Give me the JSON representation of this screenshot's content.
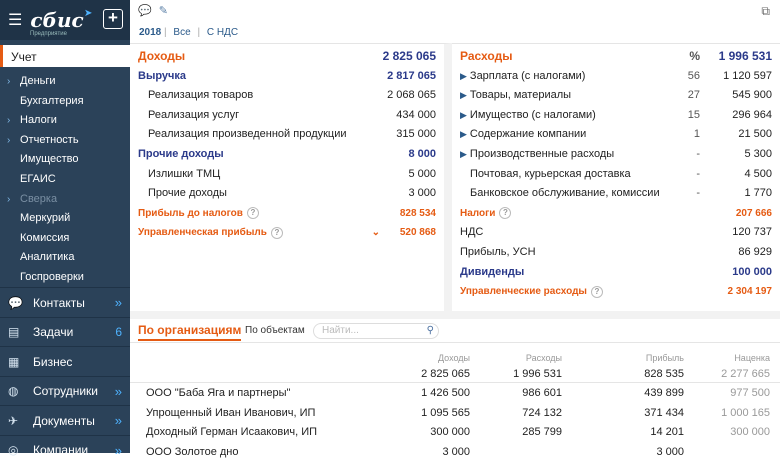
{
  "app": {
    "logo": "сбис",
    "logo_sub": "Предприятие",
    "active_section": "Учет"
  },
  "sidebar": {
    "items": [
      {
        "label": "Деньги",
        "arrow": true
      },
      {
        "label": "Бухгалтерия",
        "arrow": false
      },
      {
        "label": "Налоги",
        "arrow": true
      },
      {
        "label": "Отчетность",
        "arrow": true
      },
      {
        "label": "Имущество",
        "arrow": false
      },
      {
        "label": "ЕГАИС",
        "arrow": false
      },
      {
        "label": "Сверка",
        "arrow": true
      },
      {
        "label": "Меркурий",
        "arrow": false
      },
      {
        "label": "Комиссия",
        "arrow": false
      },
      {
        "label": "Аналитика",
        "arrow": false
      },
      {
        "label": "Госпроверки",
        "arrow": false
      }
    ],
    "sections": [
      {
        "label": "Контакты",
        "icon": "chat-icon",
        "badge": "»"
      },
      {
        "label": "Задачи",
        "icon": "tasks-icon",
        "badge": "6"
      },
      {
        "label": "Бизнес",
        "icon": "business-icon",
        "badge": ""
      },
      {
        "label": "Сотрудники",
        "icon": "people-icon",
        "badge": "»"
      },
      {
        "label": "Документы",
        "icon": "documents-icon",
        "badge": "»"
      },
      {
        "label": "Компании",
        "icon": "companies-icon",
        "badge": "»"
      }
    ]
  },
  "filters": {
    "year": "2018",
    "scope": "Все",
    "vat": "С НДС"
  },
  "income": {
    "header": {
      "label": "Доходы",
      "value": "2 825 065"
    },
    "rows": [
      {
        "label": "Выручка",
        "value": "2 817 065",
        "style": "bold"
      },
      {
        "label": "Реализация товаров",
        "value": "2 068 065",
        "style": "ind"
      },
      {
        "label": "Реализация услуг",
        "value": "434 000",
        "style": "ind"
      },
      {
        "label": "Реализация произведенной продукции",
        "value": "315 000",
        "style": "ind"
      },
      {
        "label": "Прочие доходы",
        "value": "8 000",
        "style": "bold"
      },
      {
        "label": "Излишки ТМЦ",
        "value": "5 000",
        "style": "ind"
      },
      {
        "label": "Прочие доходы",
        "value": "3 000",
        "style": "ind"
      }
    ],
    "profit_before_tax": {
      "label": "Прибыль до налогов",
      "value": "828 534"
    },
    "managerial_profit": {
      "label": "Управленческая прибыль",
      "value": "520 868"
    }
  },
  "expenses": {
    "header": {
      "label": "Расходы",
      "pct": "%",
      "value": "1 996 531"
    },
    "rows": [
      {
        "label": "Зарплата (с налогами)",
        "pct": "56",
        "value": "1 120 597",
        "tri": true
      },
      {
        "label": "Товары, материалы",
        "pct": "27",
        "value": "545 900",
        "tri": true
      },
      {
        "label": "Имущество (с налогами)",
        "pct": "15",
        "value": "296 964",
        "tri": true
      },
      {
        "label": "Содержание компании",
        "pct": "1",
        "value": "21 500",
        "tri": true
      },
      {
        "label": "Производственные расходы",
        "pct": "-",
        "value": "5 300",
        "tri": true
      },
      {
        "label": "Почтовая, курьерская доставка",
        "pct": "-",
        "value": "4 500",
        "tri": false
      },
      {
        "label": "Банковское обслуживание, комиссии",
        "pct": "-",
        "value": "1 770",
        "tri": false
      }
    ],
    "taxes": {
      "label": "Налоги",
      "value": "207 666"
    },
    "tax_rows": [
      {
        "label": "НДС",
        "value": "120 737"
      },
      {
        "label": "Прибыль, УСН",
        "value": "86 929"
      }
    ],
    "dividends": {
      "label": "Дивиденды",
      "value": "100 000"
    },
    "managerial_expenses": {
      "label": "Управленческие расходы",
      "value": "2 304 197"
    }
  },
  "orgs": {
    "tab_active": "По организациям",
    "tab_other": "По объектам",
    "search_placeholder": "Найти...",
    "columns": [
      "Доходы",
      "Расходы",
      "Прибыль",
      "Наценка"
    ],
    "totals": [
      "2 825 065",
      "1 996 531",
      "828 535",
      "2 277 665"
    ],
    "rows": [
      {
        "name": "ООО \"Баба Яга и партнеры\"",
        "values": [
          "1 426 500",
          "986 601",
          "439 899",
          "977 500"
        ]
      },
      {
        "name": "Упрощенный Иван Иванович, ИП",
        "values": [
          "1 095 565",
          "724 132",
          "371 434",
          "1 000 165"
        ]
      },
      {
        "name": "Доходный Герман Исаакович, ИП",
        "values": [
          "300 000",
          "285 799",
          "14 201",
          "300 000"
        ]
      },
      {
        "name": "ООО Золотое дно",
        "values": [
          "3 000",
          "",
          "3 000",
          ""
        ]
      }
    ]
  }
}
